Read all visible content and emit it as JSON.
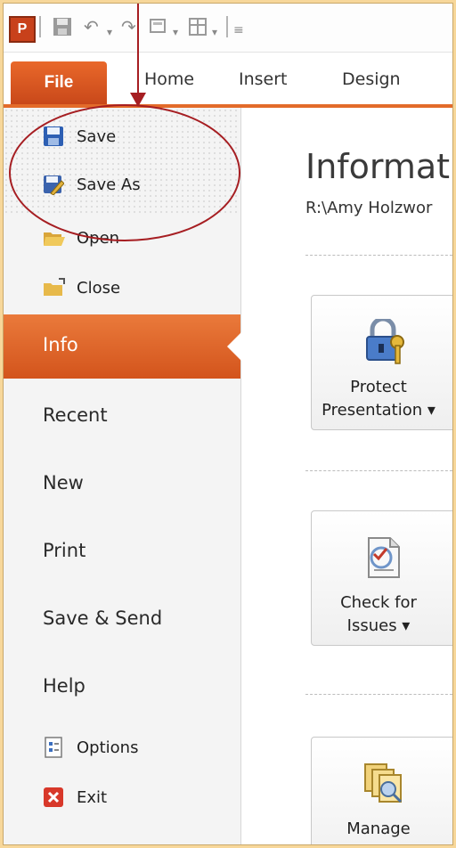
{
  "qat": {
    "app_letter": "P"
  },
  "ribbon": {
    "file_label": "File",
    "tabs": [
      "Home",
      "Insert",
      "Design"
    ]
  },
  "nav": {
    "commands_top": [
      {
        "label": "Save",
        "icon": "floppy-disk-icon"
      },
      {
        "label": "Save As",
        "icon": "save-as-icon"
      },
      {
        "label": "Open",
        "icon": "open-folder-icon"
      },
      {
        "label": "Close",
        "icon": "close-folder-icon"
      }
    ],
    "selected": "Info",
    "items": [
      "Recent",
      "New",
      "Print",
      "Save & Send",
      "Help"
    ],
    "commands_bottom": [
      {
        "label": "Options",
        "icon": "options-icon"
      },
      {
        "label": "Exit",
        "icon": "exit-icon"
      }
    ]
  },
  "main": {
    "title": "Informati",
    "path": "R:\\Amy Holzwor",
    "buttons": [
      {
        "line1": "Protect",
        "line2": "Presentation ▾",
        "icon": "lock-key-icon"
      },
      {
        "line1": "Check for",
        "line2": "Issues ▾",
        "icon": "checklist-icon"
      },
      {
        "line1": "Manage",
        "line2": "",
        "icon": "manage-versions-icon"
      }
    ]
  },
  "colors": {
    "accent": "#e36b2a",
    "annotation": "#a61e22",
    "background_border": "#f7d79a"
  }
}
